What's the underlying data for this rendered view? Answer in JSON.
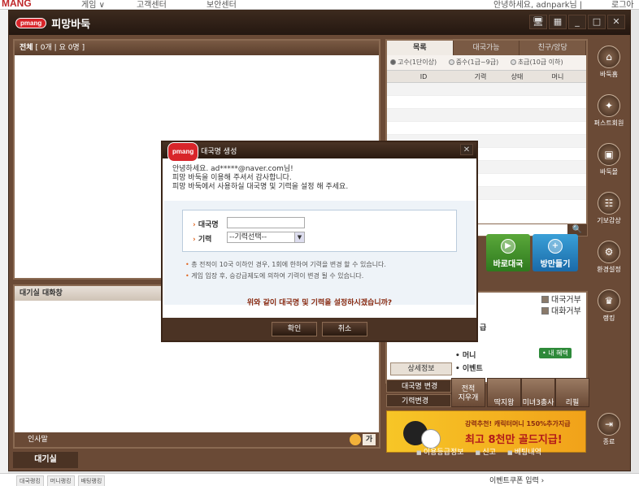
{
  "browser": {
    "logo": "MANG",
    "menu1": "게임 ∨",
    "menu2": "고객센터",
    "menu3": "보안센터",
    "welcome": "안녕하세요, adnpark님 |",
    "right_label": "로그아웃",
    "bottom_tabs": [
      "대국랭킹",
      "머니랭킹",
      "배팅랭킹"
    ],
    "coupon": "이벤트쿠폰 입력 ›"
  },
  "app": {
    "pill": "pmang",
    "title": "피망바둑",
    "win_btns": [
      "🖥",
      "▦",
      "_",
      "□",
      "✕"
    ]
  },
  "room_panel": {
    "label": "전체",
    "counts": "[ 0개 | 요 0명 ]"
  },
  "chat_panel": {
    "title": "대기실 대화창",
    "input_label": "인사말",
    "ga": "가"
  },
  "bottom_tab": "대기실",
  "list_panel": {
    "tabs": [
      "목록",
      "대국가능",
      "친구/앙당"
    ],
    "grades": [
      "고수(1단이상)",
      "중수(1급~9급)",
      "초급(10급 이하)"
    ],
    "columns": [
      "ID",
      "기력",
      "상태",
      "머니"
    ],
    "search_icon": "🔍"
  },
  "actions": {
    "quick": "바로대국",
    "room": "방만들기"
  },
  "info": {
    "refuse_game": "대국거부",
    "refuse_chat": "대화거부",
    "row1": "급",
    "money": "• 머니",
    "event": "• 이벤트",
    "benefit": "• 내 혜택",
    "detail": "상세정보"
  },
  "settings": {
    "name_change": "대국명 변경",
    "grade_change": "기력변경",
    "sq": [
      "전적\n지우개",
      "딱지왕",
      "미녀3총사",
      "리필"
    ]
  },
  "banner": {
    "line1": "강력추천! 캐릭터머니 150%추가지급",
    "line2": "최고 8천만 골드지급!"
  },
  "status": [
    "이용등급정보",
    "신고",
    "베팅내역"
  ],
  "sidenav": [
    "바둑홈",
    "퍼스트회원",
    "바둑몰",
    "기보감상",
    "환경설정",
    "랭킹"
  ],
  "sidenav_icons": [
    "⌂",
    "✦",
    "▣",
    "☷",
    "⚙",
    "♛"
  ],
  "exit": "종료",
  "dialog": {
    "title": "대국명 생성",
    "greet1": "안녕하세요. ad*****@naver.com님!",
    "greet2": "피망 바둑을 이용해 주셔서 감사합니다.",
    "greet3": "피망 바둑에서 사용하실 대국명 및 기력을 설정 해 주세요.",
    "name_label": "대국명",
    "grade_label": "기력",
    "name_value": "",
    "grade_select": "--기력선택--",
    "note1": "총 전적이 10국 이하인 경우, 1회에 한하여 기력을 변경 할 수 있습니다.",
    "note2": "게임 입장 후, 승강급제도에 의하여 기력이 변경 될 수 있습니다.",
    "question": "위와 같이 대국명 및 기력을 설정하시겠습니까?",
    "ok": "확인",
    "cancel": "취소"
  }
}
